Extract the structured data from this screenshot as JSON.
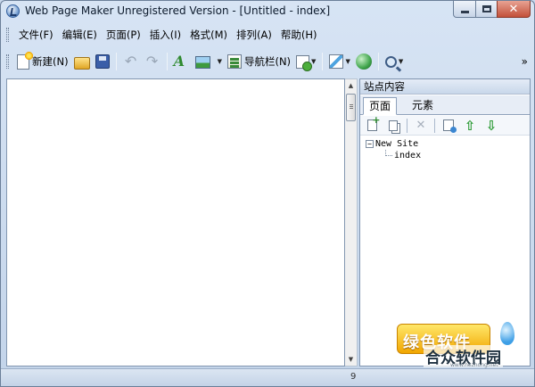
{
  "window": {
    "title": "Web Page Maker Unregistered Version - [Untitled - index]"
  },
  "menu": {
    "items": [
      {
        "label": "文件(F)"
      },
      {
        "label": "编辑(E)"
      },
      {
        "label": "页面(P)"
      },
      {
        "label": "插入(I)"
      },
      {
        "label": "格式(M)"
      },
      {
        "label": "排列(A)"
      },
      {
        "label": "帮助(H)"
      }
    ]
  },
  "toolbar": {
    "new_label": "新建(N)",
    "navbar_label": "导航栏(N)",
    "overflow": "»"
  },
  "panel": {
    "title": "站点内容",
    "tabs": [
      {
        "label": "页面"
      },
      {
        "label": "元素"
      }
    ],
    "tree": {
      "root": "New Site",
      "root_toggle": "−",
      "children": [
        "index"
      ]
    }
  },
  "status": {
    "text": "9"
  },
  "watermark": {
    "badge": "绿色软件",
    "main": "合众软件园",
    "url": "www.hezhong.net"
  },
  "icons": {
    "undo": "↶",
    "redo": "↷",
    "text": "A",
    "delete": "✕",
    "up": "⇧",
    "down": "⇩",
    "dropdown": "▼",
    "scroll_up": "▲",
    "scroll_down": "▼"
  }
}
